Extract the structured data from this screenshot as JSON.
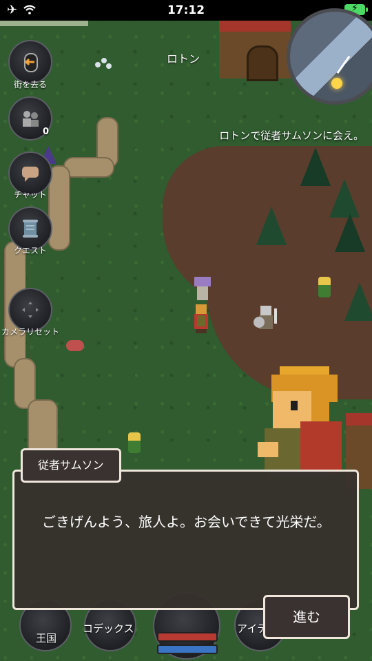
{
  "status_bar": {
    "time": "17:12"
  },
  "map": {
    "location_name": "ロトン"
  },
  "side_menu": [
    {
      "id": "leave",
      "label": "街を去る",
      "icon": "door-arrow-icon"
    },
    {
      "id": "party",
      "label": "",
      "icon": "party-icon",
      "count": "0"
    },
    {
      "id": "chat",
      "label": "チャット",
      "icon": "speech-bubble-icon"
    },
    {
      "id": "quest",
      "label": "クエスト",
      "icon": "scroll-icon"
    },
    {
      "id": "camera",
      "label": "カメラリセット",
      "icon": "dpad-icon"
    }
  ],
  "quest_tip": "ロトンで従者サムソンに会え。",
  "dialog": {
    "speaker": "従者サムソン",
    "text": "ごきげんよう、旅人よ。お会いできて光栄だ。",
    "next_label": "進む"
  },
  "bottom_menu": {
    "kingdom_label": "王国",
    "codex_label": "コデックス",
    "item_label": "アイテ"
  }
}
